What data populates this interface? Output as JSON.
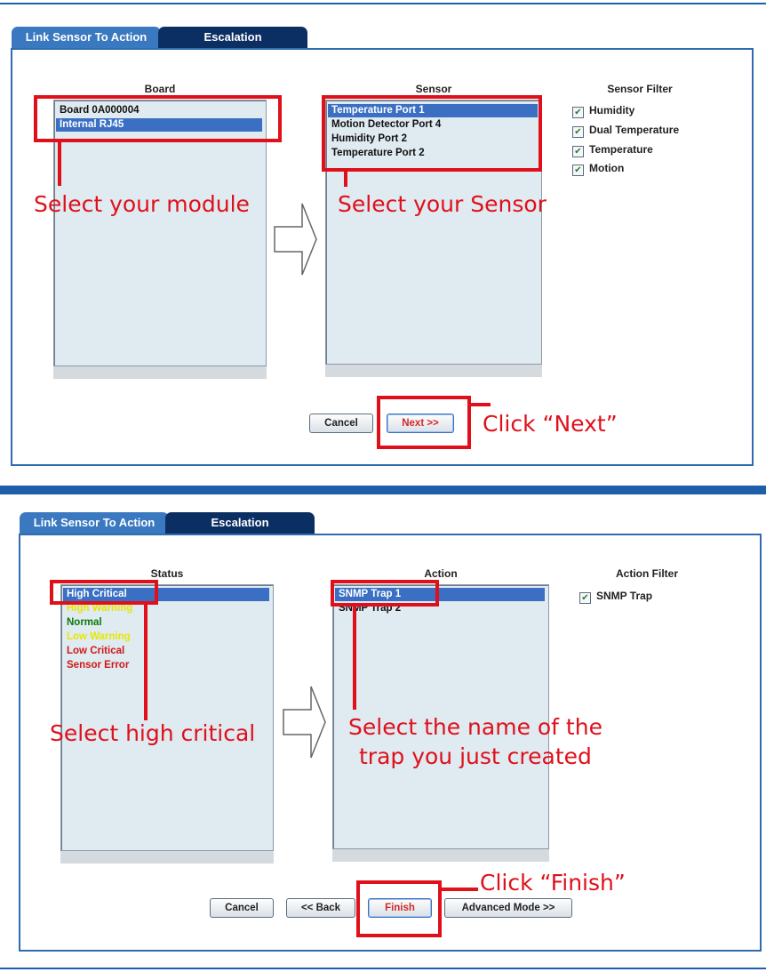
{
  "screen1": {
    "tabs": [
      {
        "label": "Link Sensor To Action",
        "active": true
      },
      {
        "label": "Escalation",
        "active": false
      }
    ],
    "board": {
      "header": "Board",
      "items": [
        {
          "label": "Board 0A000004",
          "selected": false
        },
        {
          "label": "Internal RJ45",
          "selected": true
        }
      ]
    },
    "sensor": {
      "header": "Sensor",
      "items": [
        {
          "label": "Temperature Port 1",
          "selected": true
        },
        {
          "label": "Motion Detector Port 4",
          "selected": false
        },
        {
          "label": "Humidity Port 2",
          "selected": false
        },
        {
          "label": "Temperature Port 2",
          "selected": false
        }
      ]
    },
    "filter": {
      "header": "Sensor Filter",
      "items": [
        {
          "label": "Humidity",
          "checked": true
        },
        {
          "label": "Dual Temperature",
          "checked": true
        },
        {
          "label": "Temperature",
          "checked": true
        },
        {
          "label": "Motion",
          "checked": true
        }
      ]
    },
    "buttons": {
      "cancel": "Cancel",
      "next": "Next >>"
    },
    "annotations": {
      "module": "Select your module",
      "sensor": "Select your Sensor",
      "next": "Click “Next”"
    }
  },
  "screen2": {
    "tabs": [
      {
        "label": "Link Sensor To Action",
        "active": true
      },
      {
        "label": "Escalation",
        "active": false
      }
    ],
    "status": {
      "header": "Status",
      "items": [
        {
          "label": "High Critical",
          "selected": true,
          "color": "#ffffff"
        },
        {
          "label": "High Warning",
          "selected": false,
          "color": "#e8e800"
        },
        {
          "label": "Normal",
          "selected": false,
          "color": "#0a7a0a"
        },
        {
          "label": "Low Warning",
          "selected": false,
          "color": "#e8e800"
        },
        {
          "label": "Low Critical",
          "selected": false,
          "color": "#d01818"
        },
        {
          "label": "Sensor Error",
          "selected": false,
          "color": "#d01818"
        }
      ]
    },
    "action": {
      "header": "Action",
      "items": [
        {
          "label": "SNMP Trap 1",
          "selected": true
        },
        {
          "label": "SNMP Trap 2",
          "selected": false
        }
      ]
    },
    "filter": {
      "header": "Action Filter",
      "items": [
        {
          "label": "SNMP Trap",
          "checked": true
        }
      ]
    },
    "buttons": {
      "cancel": "Cancel",
      "back": "<< Back",
      "finish": "Finish",
      "advanced": "Advanced Mode >>"
    },
    "annotations": {
      "status": "Select high critical",
      "trap_line1": "Select the name of the",
      "trap_line2": "trap you just created",
      "finish": "Click “Finish”"
    }
  },
  "colors": {
    "accent_blue": "#1f5ea8",
    "tab_active": "#3a78bf",
    "tab_inactive": "#0c2f63",
    "selection": "#3a6fc4",
    "annotation_red": "#e0101a",
    "list_bg": "#dfeaf1"
  }
}
